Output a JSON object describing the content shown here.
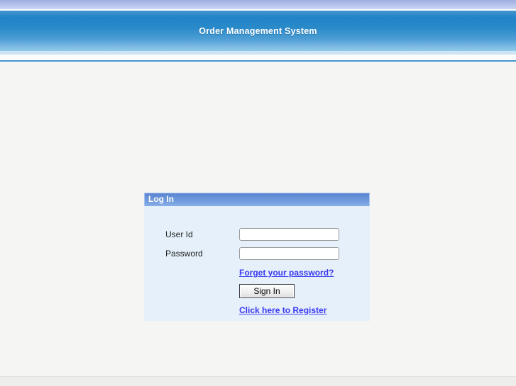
{
  "header": {
    "title": "Order Management System"
  },
  "login_panel": {
    "title": "Log In",
    "user_id_label": "User Id",
    "user_id_value": "",
    "password_label": "Password",
    "password_value": "",
    "forgot_password_link": "Forget your password?",
    "sign_in_button": "Sign In",
    "register_link": "Click here to Register"
  },
  "colors": {
    "banner_top_strip": "#b4c1ea",
    "banner_blue_top": "#2084c6",
    "banner_blue_bottom": "#93c9ec",
    "header_rule_blue": "#4697d0",
    "panel_title_bar_top": "#5b86d1",
    "panel_title_bar_bottom": "#8aafe8",
    "panel_body_background": "#e5f0fb",
    "page_body_background": "#f5f5f4",
    "link_blue": "#3a3af2"
  }
}
